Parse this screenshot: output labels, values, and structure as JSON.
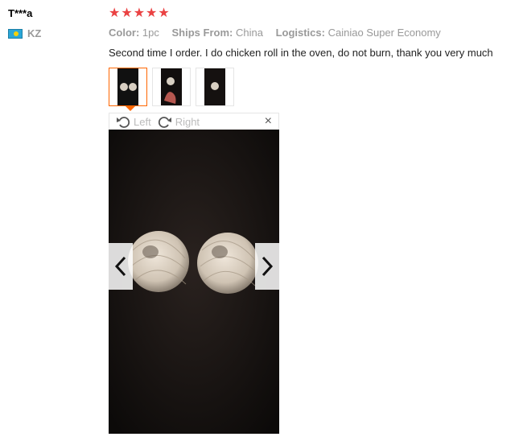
{
  "user": {
    "name": "T***a",
    "country_code": "KZ"
  },
  "rating": {
    "stars": 5,
    "star_glyph": "★",
    "color": "#ea4243"
  },
  "attributes": [
    {
      "key": "Color:",
      "value": "1pc"
    },
    {
      "key": "Ships From:",
      "value": "China"
    },
    {
      "key": "Logistics:",
      "value": "Cainiao Super Economy"
    }
  ],
  "review": {
    "text": "Second time I order. I do chicken roll in the oven, do not burn, thank you very much"
  },
  "thumbnails": {
    "count": 3,
    "selected_index": 0
  },
  "viewer": {
    "rotate_left_label": "Left",
    "rotate_right_label": "Right",
    "close_glyph": "×"
  },
  "colors": {
    "accent": "#ff6600",
    "muted": "#999999"
  }
}
